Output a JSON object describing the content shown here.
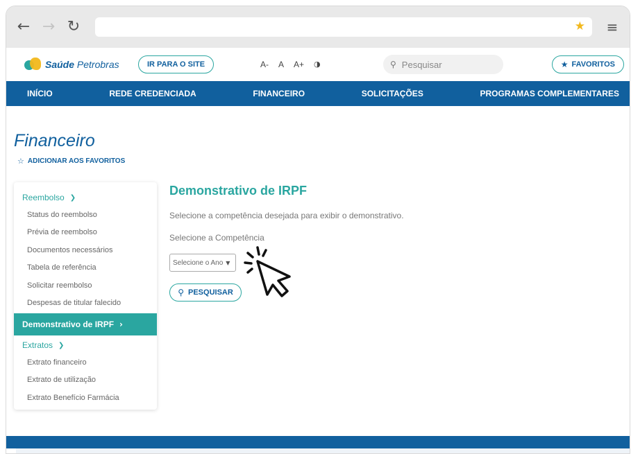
{
  "site": {
    "brand_name_bold": "Saúde",
    "brand_name_rest": " Petrobras",
    "ir_para_site": "IR PARA O SITE",
    "font_decrease": "A-",
    "font_normal": "A",
    "font_increase": "A+",
    "search_placeholder": "Pesquisar",
    "favoritos": "FAVORITOS"
  },
  "nav": [
    "INÍCIO",
    "REDE CREDENCIADA",
    "FINANCEIRO",
    "SOLICITAÇÕES",
    "PROGRAMAS COMPLEMENTARES"
  ],
  "page": {
    "title": "Financeiro",
    "add_favorite": "ADICIONAR AOS FAVORITOS"
  },
  "sidebar": {
    "group1": "Reembolso",
    "group1_items": [
      "Status do reembolso",
      "Prévia de reembolso",
      "Documentos necessários",
      "Tabela de referência",
      "Solicitar reembolso",
      "Despesas de titular falecido"
    ],
    "active": "Demonstrativo de IRPF",
    "group2": "Extratos",
    "group2_items": [
      "Extrato financeiro",
      "Extrato de utilização",
      "Extrato Benefício Farmácia"
    ]
  },
  "main": {
    "title": "Demonstrativo de IRPF",
    "description": "Selecione a competência desejada para exibir o demonstrativo.",
    "label": "Selecione a Competência",
    "select_value": "Selecione o Ano",
    "search_button": "PESQUISAR"
  },
  "colors": {
    "primary_blue": "#11609e",
    "teal": "#2aa6a0",
    "star_yellow": "#f2b81c"
  }
}
